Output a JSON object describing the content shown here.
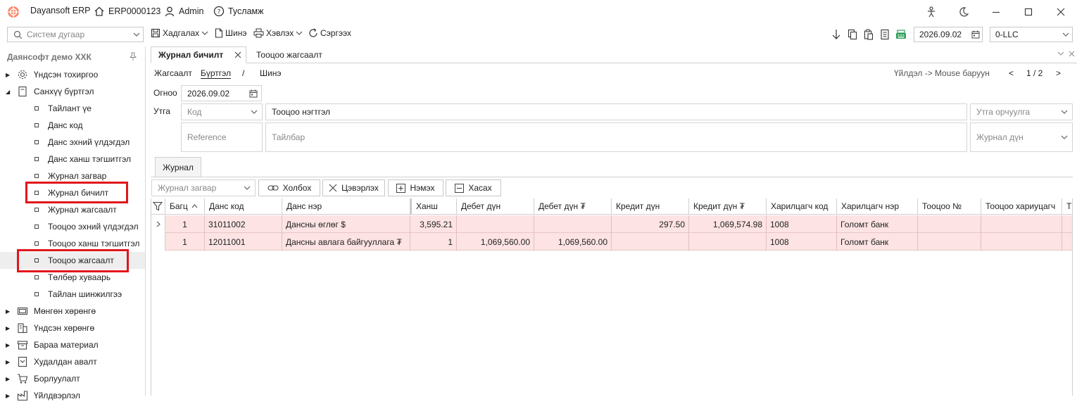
{
  "titlebar": {
    "app_name": "Dayansoft ERP",
    "home_code": "ERP0000123",
    "user": "Admin",
    "help": "Тусламж"
  },
  "toolbar": {
    "search_placeholder": "Систем дугаар",
    "save": "Хадгалах",
    "new": "Шинэ",
    "print": "Хэвлэх",
    "refresh": "Сэргээх",
    "date": "2026.09.02",
    "company": "0-LLC"
  },
  "sidebar": {
    "title": "Даянсофт демо ХХК",
    "groups": [
      {
        "label": "Үндсэн тохиргоо"
      },
      {
        "label": "Санхүү бүртгэл"
      }
    ],
    "sub_items": [
      "Тайлант үе",
      "Данс код",
      "Данс эхний үлдэгдэл",
      "Данс ханш тэгшитгэл",
      "Журнал загвар",
      "Журнал бичилт",
      "Журнал жагсаалт",
      "Тооцоо эхний үлдэгдэл",
      "Тооцоо ханш тэгшитгэл",
      "Тооцоо жагсаалт",
      "Төлбөр хуваарь",
      "Тайлан шинжилгээ"
    ],
    "bottom_groups": [
      "Мөнгөн хөрөнгө",
      "Үндсэн хөрөнгө",
      "Бараа материал",
      "Худалдан авалт",
      "Борлуулалт",
      "Үйлдвэрлэл"
    ]
  },
  "tabs": [
    "Журнал бичилт",
    "Тооцоо жагсаалт"
  ],
  "crumbs": {
    "list": "Жагсаалт",
    "register": "Бүртгэл",
    "sep": "/",
    "new": "Шинэ",
    "hint": "Үйлдэл -> Mouse баруун",
    "prev": "<",
    "page": "1 / 2",
    "next": ">"
  },
  "form": {
    "date_label": "Огноо",
    "date_value": "2026.09.02",
    "note_label": "Утга",
    "code_placeholder": "Код",
    "account_name_placeholder": "Тооцоо нэгтгэл",
    "note_translation_placeholder": "Утга орчуулга",
    "reference_placeholder": "Reference",
    "description_placeholder": "Тайлбар",
    "journal_amount_placeholder": "Журнал дүн"
  },
  "inner_tab": "Журнал",
  "grid_toolbar": {
    "template_placeholder": "Журнал загвар",
    "link": "Холбох",
    "clear": "Цэвэрлэх",
    "add": "Нэмэх",
    "remove": "Хасах"
  },
  "grid": {
    "columns": [
      "Багц",
      "Данс код",
      "Данс нэр",
      "Ханш",
      "Дебет дүн",
      "Дебет дүн ₮",
      "Кредит дүн",
      "Кредит дүн ₮",
      "Харилцагч код",
      "Харилцагч нэр",
      "Тооцоо №",
      "Тооцоо хариуцагч",
      "Тэ"
    ],
    "rows": [
      {
        "batch": "1",
        "code": "31011002",
        "name": "Дансны өглөг $",
        "rate": "3,595.21",
        "debit": "",
        "debit_mnt": "",
        "credit": "297.50",
        "credit_mnt": "1,069,574.98",
        "partner_code": "1008",
        "partner_name": "Голомт банк",
        "ref_no": "",
        "ref_owner": ""
      },
      {
        "batch": "1",
        "code": "12011001",
        "name": "Дансны авлага байгууллага ₮",
        "rate": "1",
        "debit": "1,069,560.00",
        "debit_mnt": "1,069,560.00",
        "credit": "",
        "credit_mnt": "",
        "partner_code": "1008",
        "partner_name": "Голомт банк",
        "ref_no": "",
        "ref_owner": ""
      }
    ]
  }
}
